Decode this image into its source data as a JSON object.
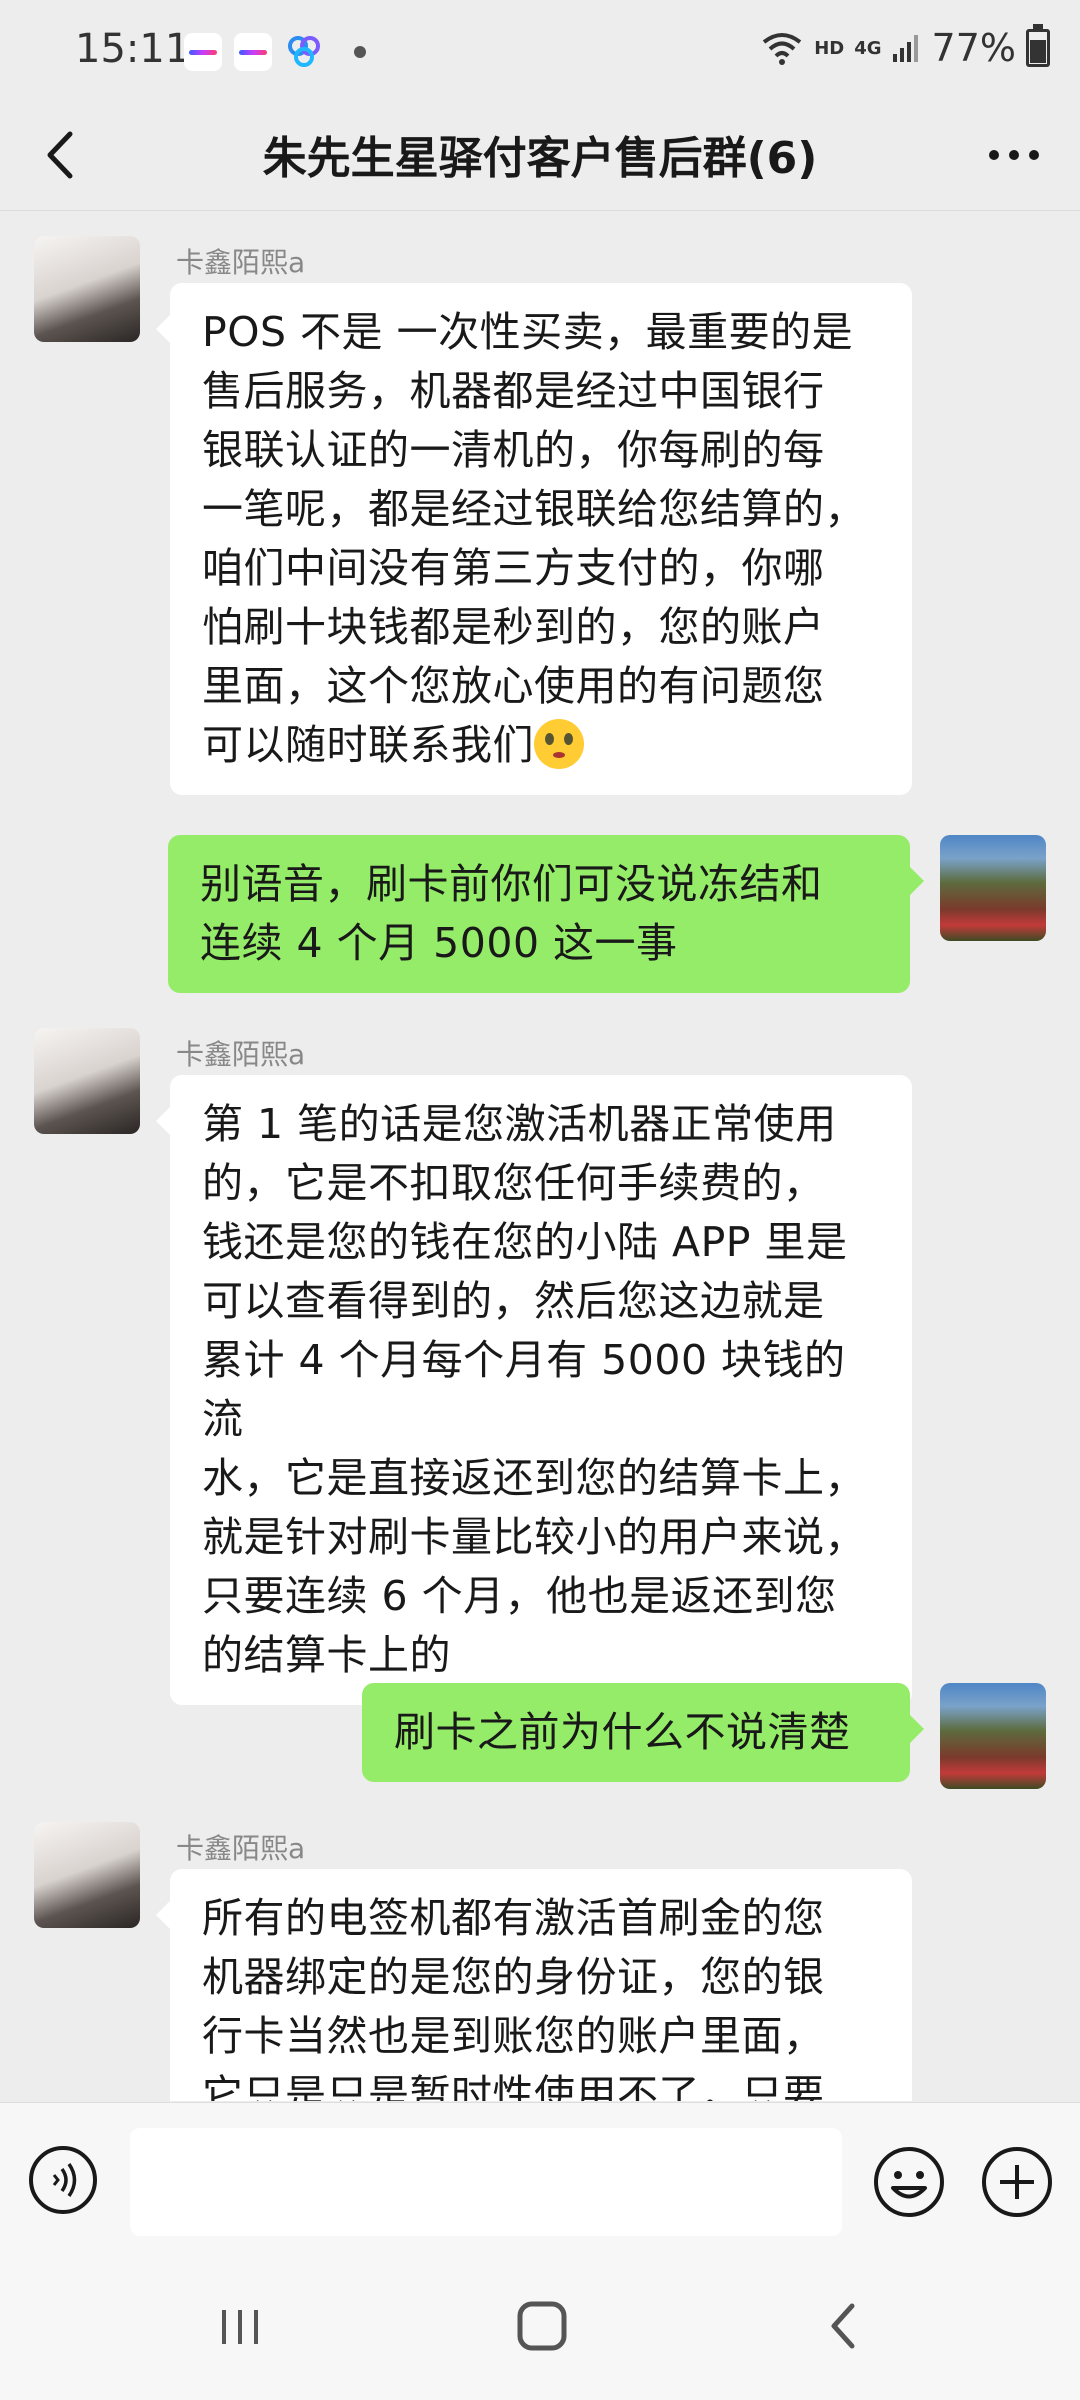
{
  "status_bar": {
    "time": "15:11",
    "network_label": "HD",
    "signal_label": "4G",
    "battery_text": "77%",
    "icons": [
      "app-icon-1",
      "app-icon-2",
      "cloud-icon",
      "wifi-icon",
      "signal-icon",
      "battery-icon"
    ]
  },
  "header": {
    "title": "朱先生星驿付客户售后群(6)",
    "back_icon": "back-icon",
    "more_icon": "more-icon"
  },
  "messages": [
    {
      "side": "left",
      "sender": "卡鑫陌熙a",
      "lines": [
        "POS 不是 一次性买卖，最重要的是",
        "售后服务，机器都是经过中国银行",
        "银联认证的一清机的，你每刷的每",
        "一笔呢，都是经过银联给您结算的，",
        "咱们中间没有第三方支付的，你哪",
        "怕刷十块钱都是秒到的，您的账户",
        "里面，这个您放心使用的有问题您",
        "可以随时联系我们"
      ],
      "emoji": "flushed-face-emoji"
    },
    {
      "side": "right",
      "lines": [
        "别语音，刷卡前你们可没说冻结和",
        "连续 4 个月 5000 这一事"
      ]
    },
    {
      "side": "left",
      "sender": "卡鑫陌熙a",
      "lines": [
        "第 1 笔的话是您激活机器正常使用",
        "的，它是不扣取您任何手续费的，",
        "钱还是您的钱在您的小陆 APP 里是",
        "可以查看得到的，然后您这边就是",
        "累计 4 个月每个月有 5000 块钱的流",
        "水，它是直接返还到您的结算卡上，",
        "就是针对刷卡量比较小的用户来说，",
        "只要连续 6 个月，他也是返还到您",
        "的结算卡上的"
      ]
    },
    {
      "side": "right",
      "lines": [
        "刷卡之前为什么不说清楚"
      ]
    },
    {
      "side": "left",
      "sender": "卡鑫陌熙a",
      "lines": [
        "所有的电签机都有激活首刷金的您",
        "机器绑定的是您的身份证，您的银",
        "行卡当然也是到账您的账户里面，",
        "它只是只是暂时性使用不了，只要"
      ]
    }
  ],
  "input_bar": {
    "value": "",
    "placeholder": "",
    "icons": [
      "voice-icon",
      "emoji-icon",
      "plus-icon"
    ]
  },
  "nav_bar": {
    "icons": [
      "recent-apps-icon",
      "home-icon",
      "back-nav-icon"
    ]
  }
}
